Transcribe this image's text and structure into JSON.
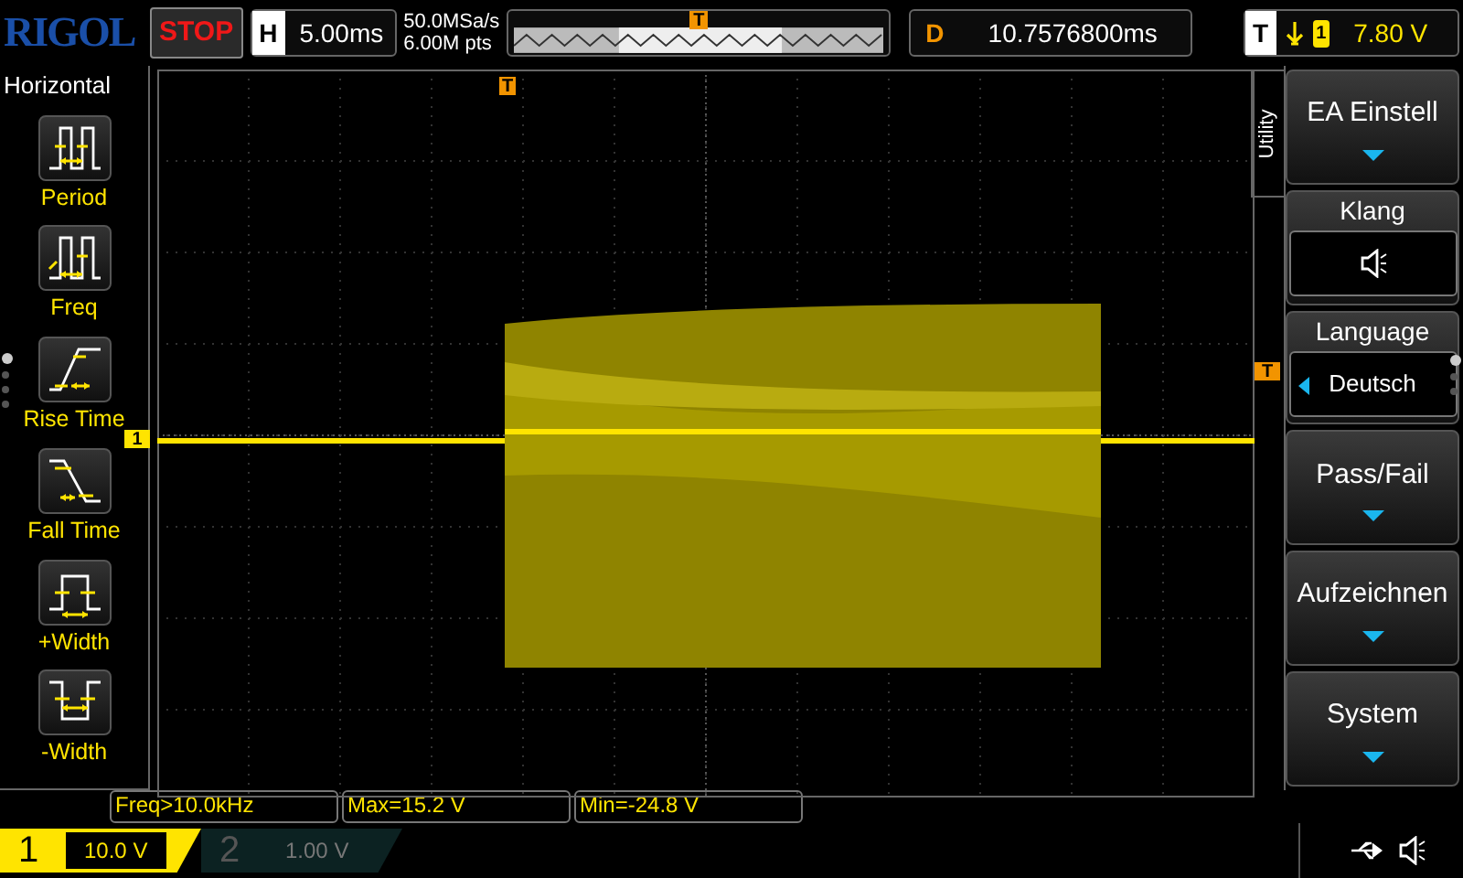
{
  "top_bar": {
    "logo": "RIGOL",
    "run_state": "STOP",
    "timebase_label": "H",
    "timebase": "5.00ms",
    "sample_rate": "50.0MSa/s",
    "memory_depth": "6.00M pts",
    "trigger_position_marker": "T",
    "delay_label": "D",
    "delay": "10.7576800ms",
    "trigger_label": "T",
    "trigger_source": "1",
    "trigger_level": "7.80 V"
  },
  "left_menu": {
    "title": "Horizontal",
    "items": [
      {
        "kind": "period",
        "label": "Period"
      },
      {
        "kind": "freq",
        "label": "Freq"
      },
      {
        "kind": "rise",
        "label": "Rise Time"
      },
      {
        "kind": "fall",
        "label": "Fall Time"
      },
      {
        "kind": "pwidth",
        "label": "+Width"
      },
      {
        "kind": "nwidth",
        "label": "-Width"
      }
    ],
    "page_dots": [
      {
        "selected": true
      },
      {
        "selected": false
      },
      {
        "selected": false
      },
      {
        "selected": false
      }
    ]
  },
  "plot": {
    "channel_marker": "1",
    "trigger_level_marker": "T",
    "trigger_time_marker": "T"
  },
  "right_menu": {
    "tab": "Utility",
    "items": [
      {
        "kind": "submenu",
        "label": "EA Einstell"
      },
      {
        "kind": "sound",
        "label": "Klang"
      },
      {
        "kind": "select",
        "label": "Language",
        "value": "Deutsch"
      },
      {
        "kind": "submenu",
        "label": "Pass/Fail"
      },
      {
        "kind": "submenu",
        "label": "Aufzeichnen"
      },
      {
        "kind": "submenu",
        "label": "System"
      }
    ],
    "page_dots": [
      {
        "selected": true
      },
      {
        "selected": false
      },
      {
        "selected": false
      }
    ]
  },
  "measurements": [
    "Freq>10.0kHz",
    "Max=15.2 V",
    "Min=-24.8 V"
  ],
  "channels": [
    {
      "number": "1",
      "scale": "10.0 V",
      "active": true
    },
    {
      "number": "2",
      "scale": "1.00 V",
      "active": false
    }
  ]
}
